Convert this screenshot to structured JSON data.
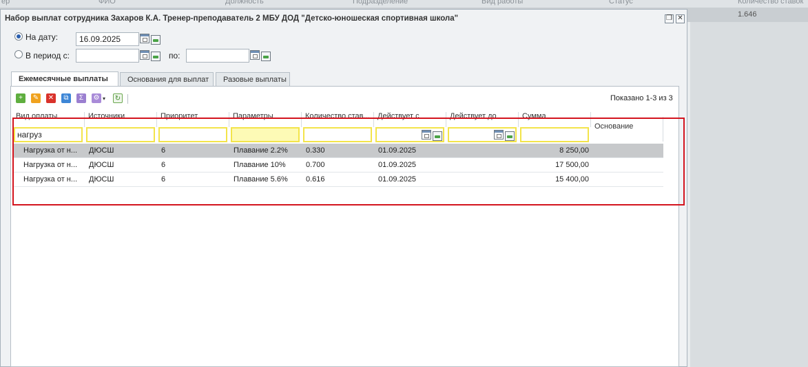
{
  "background_grid": {
    "headers": [
      "ер",
      "ФИО",
      "Должность",
      "Подразделение",
      "Вид работы",
      "Статус",
      "Количество ставок"
    ],
    "visible_value": "1.646"
  },
  "dialog": {
    "title": "Набор выплат сотрудника Захаров К.А. Тренер-преподаватель 2 МБУ ДОД \"Детско-юношеская спортивная школа\"",
    "restore_glyph": "❐",
    "close_glyph": "✕",
    "on_date_label": "На дату:",
    "on_date_value": "16.09.2025",
    "period_from_label": "В период с:",
    "period_from_value": "",
    "period_to_label": "по:",
    "period_to_value": ""
  },
  "tabs": [
    {
      "label": "Ежемесячные выплаты",
      "active": true
    },
    {
      "label": "Основания для выплат",
      "active": false
    },
    {
      "label": "Разовые выплаты",
      "active": false
    }
  ],
  "toolbar": {
    "icons": [
      "add-icon",
      "edit-icon",
      "delete-icon",
      "copy-icon",
      "sum-icon",
      "settings-icon",
      "refresh-icon"
    ],
    "paging_text": "Показано 1-3 из 3"
  },
  "grid": {
    "columns": [
      "Вид оплаты",
      "Источники",
      "Приоритет",
      "Параметры",
      "Количество став...",
      "Действует с",
      "Действует до",
      "Сумма",
      "Основание"
    ],
    "filters": {
      "vid_oplaty": "нагруз",
      "istochniki": "",
      "prioritet": "",
      "parametry": "",
      "kolichestvo": "",
      "deystvuet_s": "",
      "deystvuet_do": "",
      "summa": ""
    },
    "rows": [
      {
        "vid": "Нагрузка от н...",
        "source": "ДЮСШ",
        "priority": "6",
        "params": "Плавание 2.2%",
        "qty": "0.330",
        "from": "01.09.2025",
        "to": "",
        "sum": "8 250,00",
        "basis": "",
        "selected": true
      },
      {
        "vid": "Нагрузка от н...",
        "source": "ДЮСШ",
        "priority": "6",
        "params": "Плавание 10%",
        "qty": "0.700",
        "from": "01.09.2025",
        "to": "",
        "sum": "17 500,00",
        "basis": "",
        "selected": false
      },
      {
        "vid": "Нагрузка от н...",
        "source": "ДЮСШ",
        "priority": "6",
        "params": "Плавание 5.6%",
        "qty": "0.616",
        "from": "01.09.2025",
        "to": "",
        "sum": "15 400,00",
        "basis": "",
        "selected": false
      }
    ]
  },
  "colors": {
    "highlight_frame": "#d3131d",
    "filter_border": "#f3e44a",
    "selected_row": "#c7c9cb"
  }
}
